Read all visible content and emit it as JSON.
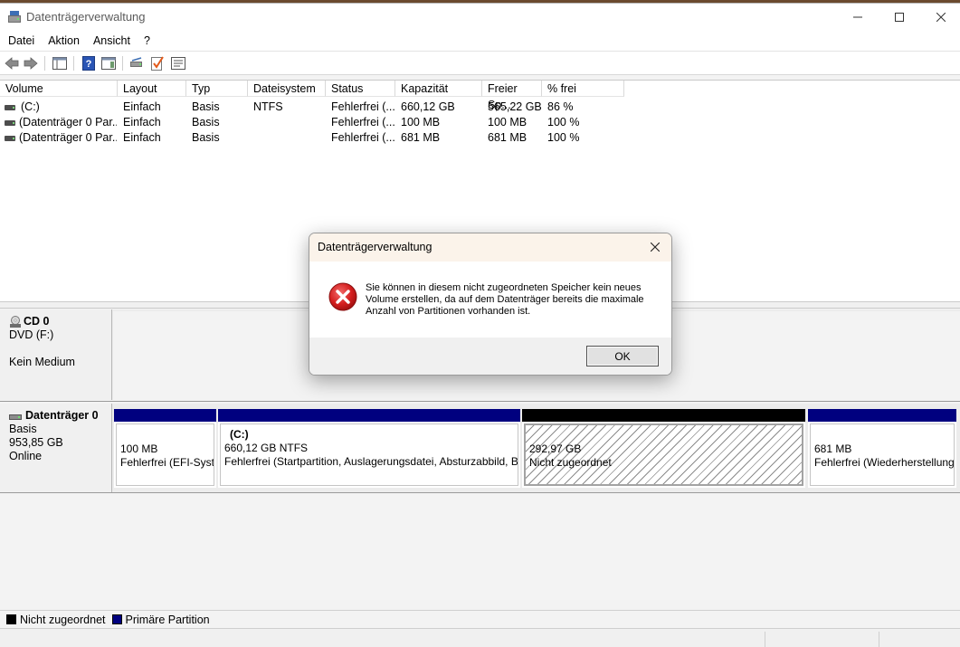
{
  "window": {
    "title": "Datenträgerverwaltung"
  },
  "menu": {
    "items": [
      "Datei",
      "Aktion",
      "Ansicht",
      "?"
    ]
  },
  "volumes": {
    "columns": [
      "Volume",
      "Layout",
      "Typ",
      "Dateisystem",
      "Status",
      "Kapazität",
      "Freier Sp...",
      "% frei"
    ],
    "rows": [
      [
        "(C:)",
        "Einfach",
        "Basis",
        "NTFS",
        "Fehlerfrei (...",
        "660,12 GB",
        "565,22 GB",
        "86 %"
      ],
      [
        "(Datenträger 0 Par...",
        "Einfach",
        "Basis",
        "",
        "Fehlerfrei (...",
        "100 MB",
        "100 MB",
        "100 %"
      ],
      [
        "(Datenträger 0 Par...",
        "Einfach",
        "Basis",
        "",
        "Fehlerfrei (...",
        "681 MB",
        "681 MB",
        "100 %"
      ]
    ]
  },
  "disks": {
    "cd": {
      "name": "CD 0",
      "drive": "DVD (F:)",
      "media": "Kein Medium"
    },
    "disk0": {
      "name": "Datenträger 0",
      "type": "Basis",
      "size": "953,85 GB",
      "state": "Online",
      "partitions": [
        {
          "title": "",
          "size": "100 MB",
          "status": "Fehlerfrei (EFI-Systempartition)",
          "kind": "primary"
        },
        {
          "title": "(C:)",
          "size": "660,12 GB NTFS",
          "status": "Fehlerfrei (Startpartition, Auslagerungsdatei, Absturzabbild, Basisdatenpartition)",
          "kind": "primary"
        },
        {
          "title": "",
          "size": "292,97 GB",
          "status": "Nicht zugeordnet",
          "kind": "unallocated"
        },
        {
          "title": "",
          "size": "681 MB",
          "status": "Fehlerfrei (Wiederherstellungspartition)",
          "kind": "primary"
        }
      ]
    }
  },
  "legend": {
    "unallocated": "Nicht zugeordnet",
    "primary": "Primäre Partition"
  },
  "colors": {
    "primary": "#00007f",
    "unallocated": "#000000"
  },
  "dialog": {
    "title": "Datenträgerverwaltung",
    "message": "Sie können in diesem nicht zugeordneten Speicher kein neues Volume erstellen, da auf dem Datenträger bereits die maximale Anzahl von Partitionen vorhanden ist.",
    "icon": "error-icon",
    "ok_label": "OK"
  }
}
